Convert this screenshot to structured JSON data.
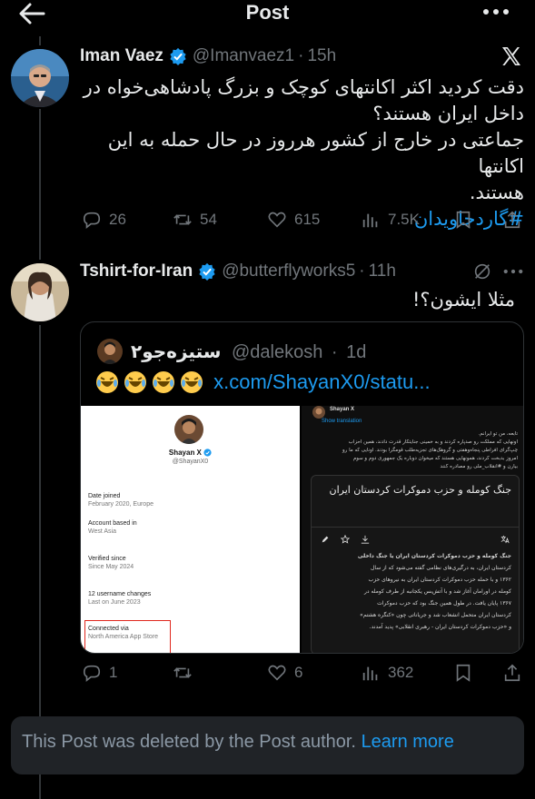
{
  "header": {
    "title": "Post",
    "back_icon": "back-arrow-icon",
    "more_icon": "more-horizontal-icon"
  },
  "post": {
    "author_name": "Iman Vaez",
    "handle": "@Imanvaez1",
    "time": "15h",
    "text_lines": [
      "دقت کردید اکثر اکانتهای کوچک و بزرگ پادشاهی‌خواه در",
      "داخل ایران هستند؟",
      "جماعتی در خارج از کشور هرروز در حال حمله به این اکانتها",
      "هستند."
    ],
    "hashtag": "#گاردجاویدان",
    "stats": {
      "replies": "26",
      "reposts": "54",
      "likes": "615",
      "views": "7.5K"
    }
  },
  "reply": {
    "author_name": "Tshirt-for-Iran",
    "handle": "@butterflyworks5",
    "time": "11h",
    "text": "مثلا ایشون؟!",
    "quote": {
      "author_name": "ستیزه‌جو۲",
      "handle": "@dalekosh",
      "time": "1d",
      "link": "x.com/ShayanX0/statu...",
      "left_shot": {
        "name": "Shayan X",
        "handle": "@ShayanX0",
        "rows": [
          {
            "label": "Date joined",
            "value": "February 2020, Europe"
          },
          {
            "label": "Account based in",
            "value": "West Asia"
          },
          {
            "label": "Verified since",
            "value": "Since May 2024"
          },
          {
            "label": "12 username changes",
            "value": "Last on June 2023"
          },
          {
            "label": "Connected via",
            "value": "North America App Store"
          }
        ]
      },
      "right_shot": {
        "name": "Shayan X",
        "show_translation": "Show translation",
        "para1_lines": [
          "تابعه، من تو ایرانم.",
          "اونهایی که مملکت رو صدپاره کردند و به خمینی جنایتکار قدرت دادند، همین احزاب",
          "چپ‌گرای افراطی پنجاه‌وهفتی و گروهک‌های تجزیه‌طلب قومگرا بودند. اونایی که ما رو",
          "امروز بدبخت کردند، همونهایی هستند که میخوان دوباره یک جمهوری دوم و سوم",
          "بیارن و #انقلاب_ملی رو مصادره کنند"
        ],
        "card_title": "جنگ کومله و حزب دموکرات کردستان ایران",
        "article_lines": [
          "جنگ کومله و حزب دموکرات کردستان ایران یا جنگ داخلی",
          "کردستان ایران، به درگیری‌های نظامی گفته می‌شود که از سال",
          "۱۳۶۲ و با حمله حزب دموکرات کردستان ایران به نیروهای حزب",
          "کومله در اورامان آغاز شد و با آتش‌بس یکجانبه از طرف کومله در",
          "۱۳۶۷ پایان یافت. در طول همین جنگ بود که حزب دموکرات",
          "کردستان ایران متحمل انشعاب شد و جریاناتی چون «کنگره هشتم»",
          "و «حزب دموکرات کردستان ایران - رهبری انقلابی» پدید آمدند."
        ]
      },
      "stats": {
        "replies": "1",
        "reposts": "",
        "likes": "6",
        "views": "362"
      }
    }
  },
  "deleted_notice": {
    "text": "This Post was deleted by the Post author.",
    "link": "Learn more"
  },
  "colors": {
    "accent": "#1d9bf0",
    "background": "#000000",
    "muted": "#71767b"
  }
}
